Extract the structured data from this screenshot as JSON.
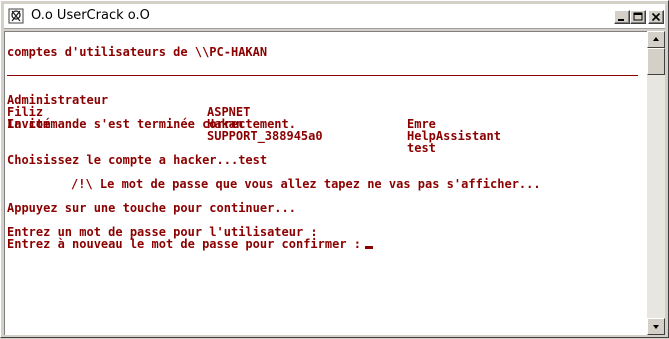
{
  "window": {
    "title": "O.o UserCrack o.O",
    "icon": "cmd-app-icon"
  },
  "controls": {
    "minimize": "minimize-icon",
    "maximize": "maximize-icon",
    "close": "close-icon"
  },
  "console": {
    "header": "comptes d'utilisateurs de \\\\PC-HAKAN",
    "users": [
      [
        "Administrateur",
        "ASPNET",
        "Emre"
      ],
      [
        "Filiz",
        "Hakan",
        "HelpAssistant"
      ],
      [
        "Invité",
        "SUPPORT_388945a0",
        "test"
      ]
    ],
    "cmd_done": "La commande s'est terminée correctement.",
    "choose": "Choisissez le compte a hacker...test",
    "warning": "/!\\ Le mot de passe que vous allez tapez ne vas pas s'afficher...",
    "press_key": "Appuyez sur une touche pour continuer...",
    "enter_pw": "Entrez un mot de passe pour l'utilisateur :",
    "confirm_pw": "Entrez à nouveau le mot de passe pour confirmer :"
  },
  "colors": {
    "text": "#8b0000",
    "background": "#ffffff"
  }
}
